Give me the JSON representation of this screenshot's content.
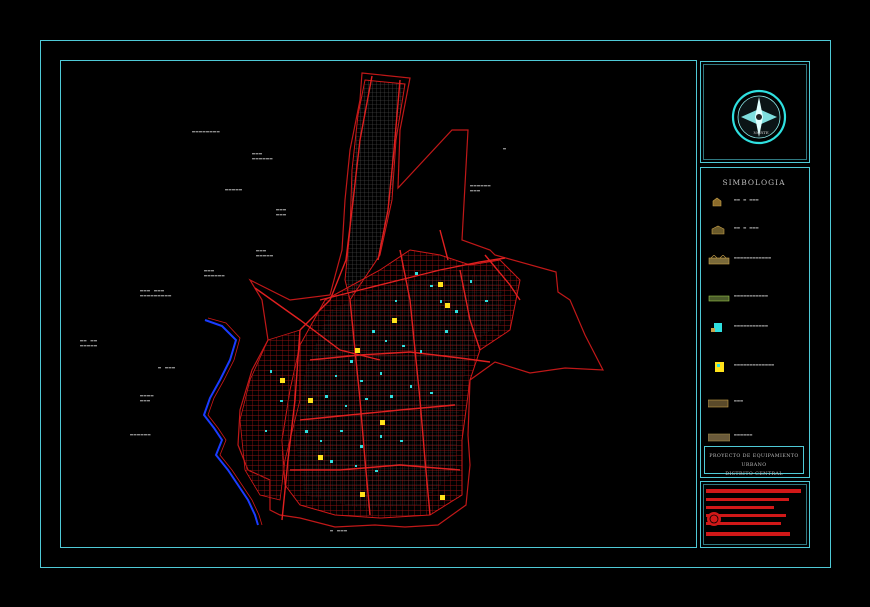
{
  "legend": {
    "title": "SIMBOLOGIA"
  },
  "north_label": "NORTE",
  "title_block": {
    "line1": "PROYECTO DE EQUIPAMIENTO URBANO",
    "line2": "DISTRITO CENTRAL"
  },
  "colors": {
    "frame": "#4fc9d6",
    "roads": "#d01818",
    "blocks": "#5a5a5a",
    "river": "#1a3cff",
    "buildings": "#2fe0e0",
    "markers": "#ffe21a",
    "title_bars": "#d01818"
  }
}
